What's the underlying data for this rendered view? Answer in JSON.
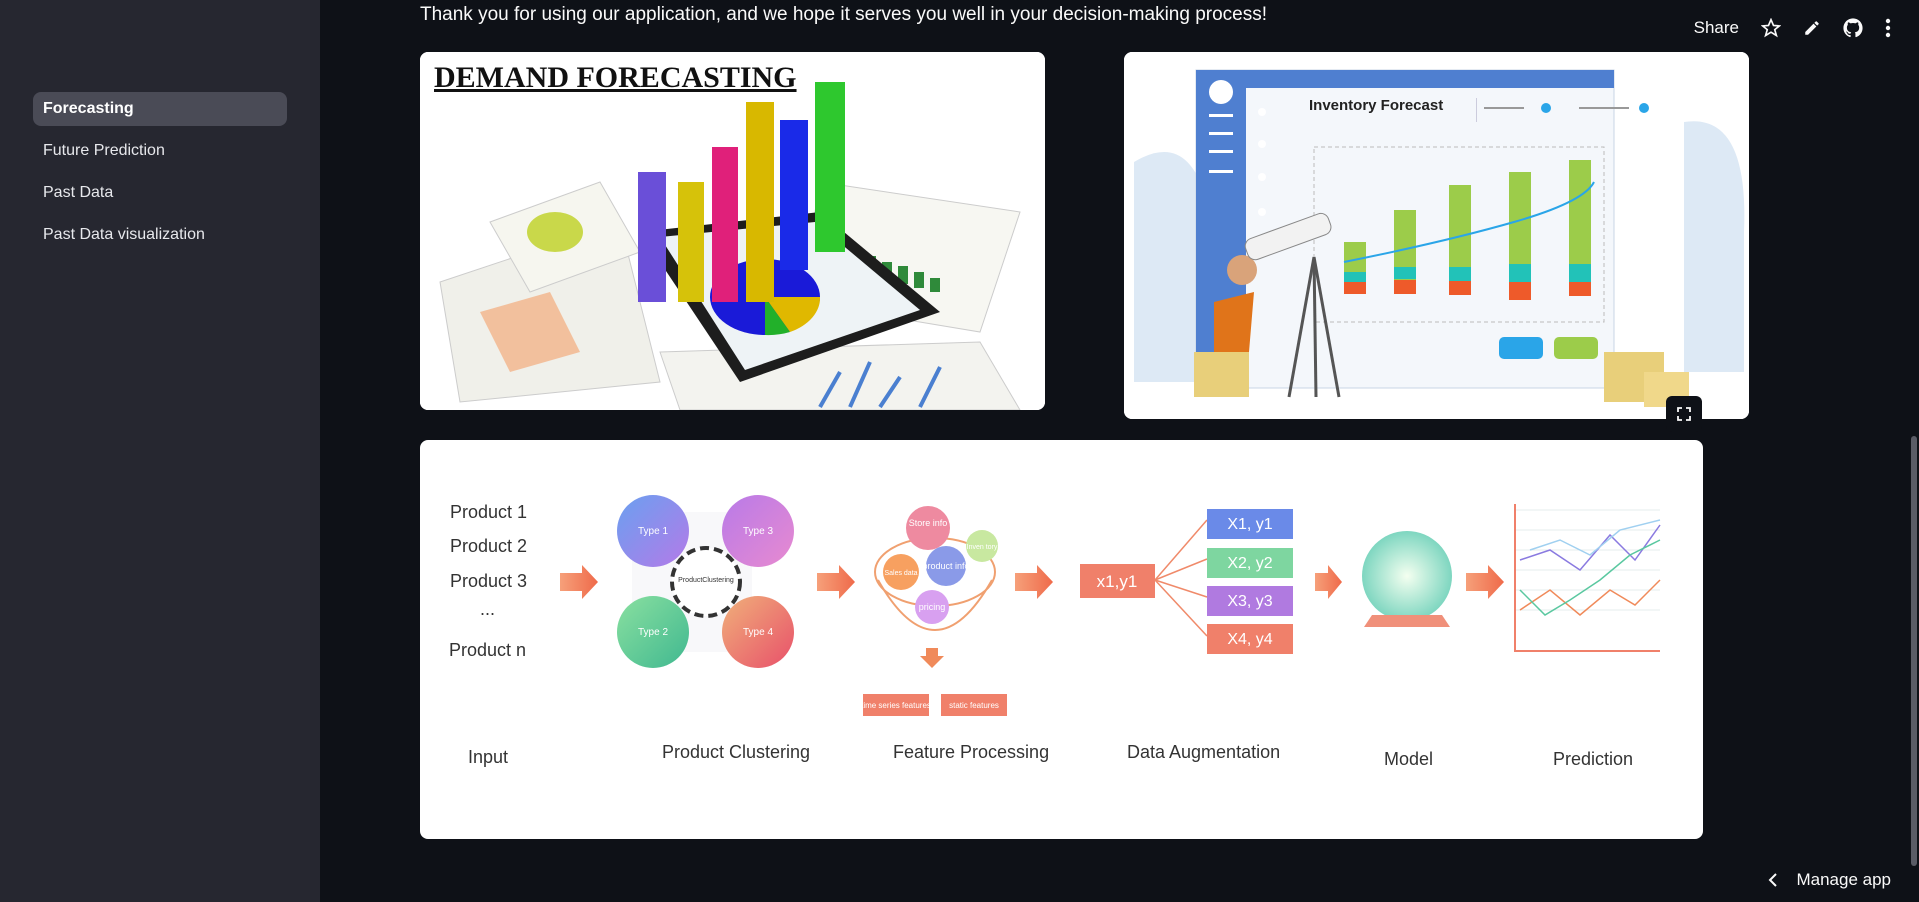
{
  "sidebar": {
    "items": [
      {
        "label": "Forecasting",
        "active": true
      },
      {
        "label": "Future Prediction",
        "active": false
      },
      {
        "label": "Past Data",
        "active": false
      },
      {
        "label": "Past Data visualization",
        "active": false
      }
    ]
  },
  "toolbar": {
    "share_label": "Share",
    "icons": [
      "star-icon",
      "pencil-icon",
      "github-icon",
      "more-vertical-icon"
    ]
  },
  "main": {
    "intro_text": "Thank you for using our application, and we hope it serves you well in your decision-making process!",
    "image1": {
      "title": "DEMAND FORECASTING"
    },
    "image2": {
      "title": "Inventory Forecast"
    },
    "pipeline": {
      "products": [
        "Product 1",
        "Product 2",
        "Product 3",
        "...",
        "Product n"
      ],
      "cluster_types": [
        "Type 1",
        "Type 3",
        "Type 2",
        "Type 4"
      ],
      "cluster_center": "ProductClustering",
      "feature_bubbles": [
        "Store info",
        "Inven tory",
        "Sales data",
        "product info",
        "pricing"
      ],
      "feature_outputs": [
        "time series features",
        "static features"
      ],
      "augment_input": "x1,y1",
      "augment_outputs": [
        "X1, y1",
        "X2, y2",
        "X3, y3",
        "X4, y4"
      ],
      "stages": [
        "Input",
        "Product Clustering",
        "Feature Processing",
        "Data Augmentation",
        "Model",
        "Prediction"
      ]
    }
  },
  "manage_app": {
    "label": "Manage app"
  },
  "colors": {
    "app_bg": "#0e1117",
    "sidebar_bg": "#262730",
    "active_nav_bg": "#4a4b56"
  }
}
